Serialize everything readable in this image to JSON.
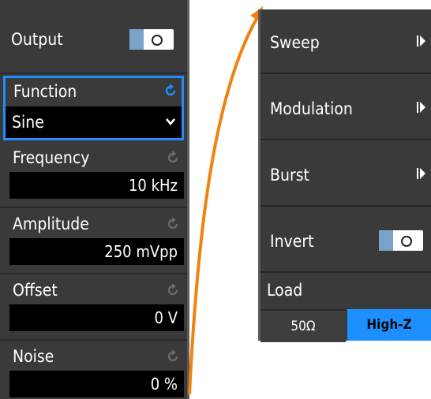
{
  "left_panel": {
    "output": {
      "label": "Output",
      "toggle_on": false
    },
    "function": {
      "label": "Function",
      "value": "Sine"
    },
    "frequency": {
      "label": "Frequency",
      "value": "10 kHz"
    },
    "amplitude": {
      "label": "Amplitude",
      "value": "250 mVpp"
    },
    "offset": {
      "label": "Offset",
      "value": "0 V"
    },
    "noise": {
      "label": "Noise",
      "value": "0 %"
    }
  },
  "right_panel": {
    "items": [
      {
        "label": "Sweep"
      },
      {
        "label": "Modulation"
      },
      {
        "label": "Burst"
      }
    ],
    "invert": {
      "label": "Invert",
      "toggle_on": false
    },
    "load": {
      "label": "Load",
      "options": [
        "50Ω",
        "High-Z"
      ],
      "selected": "High-Z"
    }
  },
  "colors": {
    "panel_bg": "#3a3a3a",
    "value_bg": "#000000",
    "accent_blue": "#1e8fff",
    "focus_border": "#1e8fff",
    "annotation_arrow": "#f0820f",
    "toggle_knob": "#7aa3c8"
  },
  "icons": {
    "reset": "reset-icon",
    "submenu": "submenu-arrow-icon",
    "dropdown": "chevron-down-icon"
  }
}
